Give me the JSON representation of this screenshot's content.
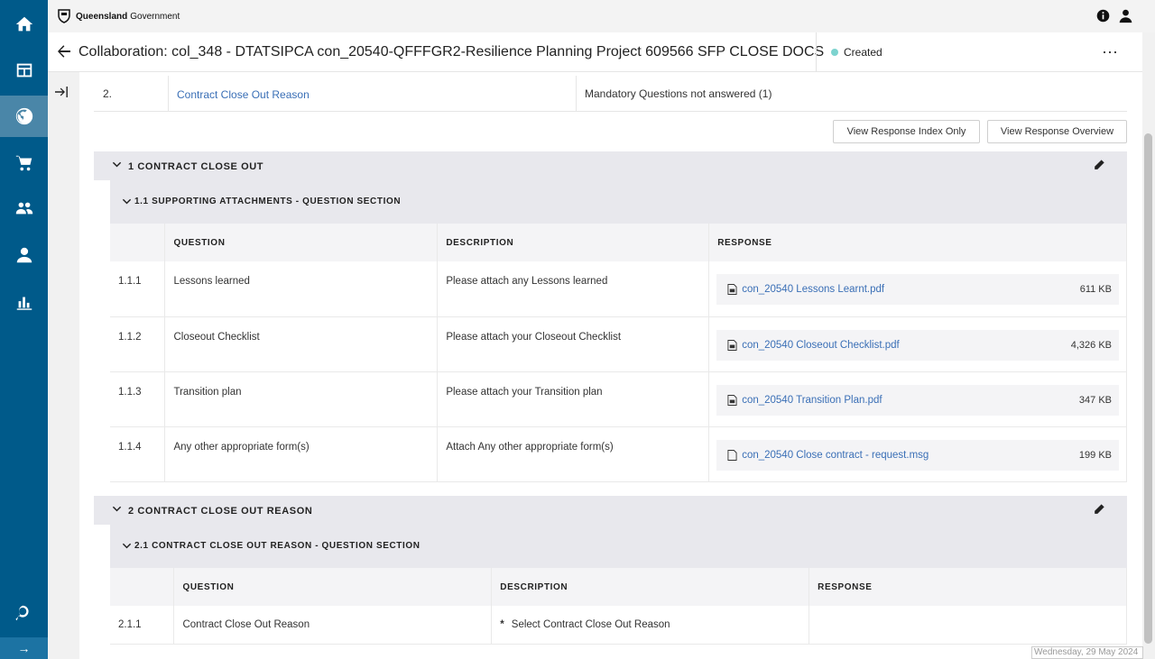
{
  "brand": {
    "name_bold": "Queensland",
    "name_rest": "Government"
  },
  "header": {
    "title": "Collaboration: col_348 - DTATSIPCA con_20540-QFFFGR2-Resilience Planning Project 609566 SFP CLOSE DOCS",
    "status": "Created",
    "more": "⋯"
  },
  "top_row": {
    "num": "2.",
    "link": "Contract Close Out Reason",
    "note": "Mandatory Questions not answered (1)"
  },
  "buttons": {
    "index_only": "View Response Index Only",
    "overview": "View Response Overview"
  },
  "section1": {
    "title": "1 CONTRACT CLOSE OUT",
    "subsection": "1.1 SUPPORTING ATTACHMENTS - QUESTION SECTION",
    "columns": [
      "QUESTION",
      "DESCRIPTION",
      "RESPONSE"
    ],
    "rows": [
      {
        "num": "1.1.1",
        "question": "Lessons learned",
        "description": "Please attach any Lessons learned",
        "file": "con_20540 Lessons Learnt.pdf",
        "size": "611 KB"
      },
      {
        "num": "1.1.2",
        "question": "Closeout Checklist",
        "description": "Please attach your Closeout Checklist",
        "file": "con_20540 Closeout Checklist.pdf",
        "size": "4,326 KB"
      },
      {
        "num": "1.1.3",
        "question": "Transition plan",
        "description": "Please attach your Transition plan",
        "file": "con_20540 Transition Plan.pdf",
        "size": "347 KB"
      },
      {
        "num": "1.1.4",
        "question": "Any other appropriate form(s)",
        "description": "Attach Any other appropriate form(s)",
        "file": "con_20540 Close contract - request.msg",
        "size": "199 KB"
      }
    ]
  },
  "section2": {
    "title": "2 CONTRACT CLOSE OUT REASON",
    "subsection": "2.1 CONTRACT CLOSE OUT REASON - QUESTION SECTION",
    "columns": [
      "QUESTION",
      "DESCRIPTION",
      "RESPONSE"
    ],
    "rows": [
      {
        "num": "2.1.1",
        "question": "Contract Close Out Reason",
        "required": "*",
        "description": "Select Contract Close Out Reason",
        "response": ""
      }
    ]
  },
  "footer_date": "Wednesday, 29 May 2024",
  "rail_bottom_arrow": "→",
  "colors": {
    "rail": "#005a8a",
    "rail_active": "#4a86a8",
    "link": "#3a6fb6",
    "status_dot": "#7dd3cf"
  }
}
